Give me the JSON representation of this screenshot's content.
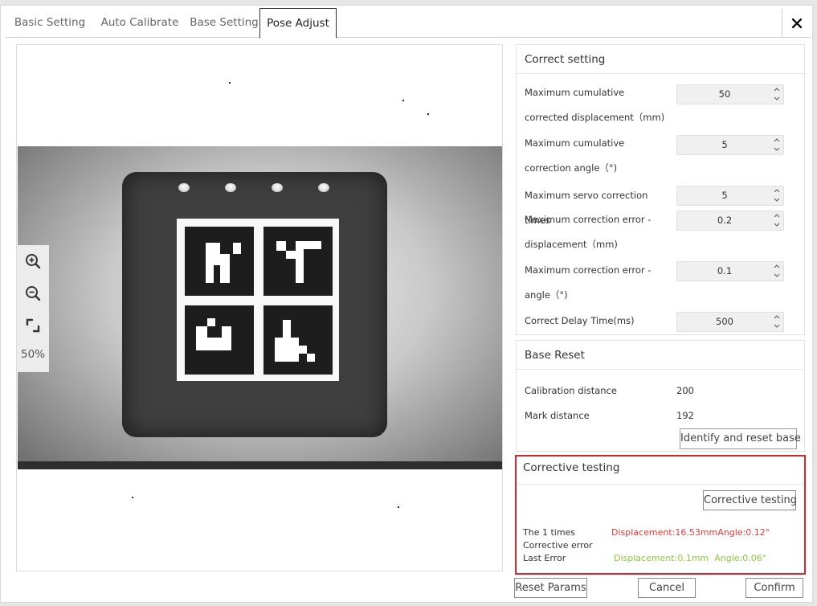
{
  "tabs": [
    "Basic Setting",
    "Auto Calibrate",
    "Base Setting",
    "Pose Adjust"
  ],
  "active_tab": "Pose Adjust",
  "close_icon": "close-icon",
  "viewer": {
    "zoom_level": "50%",
    "tools": [
      "zoom-in-icon",
      "zoom-out-icon",
      "fit-screen-icon"
    ]
  },
  "correct_setting": {
    "title": "Correct setting",
    "rows": [
      {
        "label": "Maximum cumulative corrected displacement（mm)",
        "value": "50"
      },
      {
        "label": "Maximum cumulative correction angle（°)",
        "value": "5"
      },
      {
        "label": "Maximum servo correction times",
        "value": "5"
      },
      {
        "label": "Maximum correction error - displacement（mm)",
        "value": "0.2"
      },
      {
        "label": "Maximum correction error - angle（°)",
        "value": "0.1"
      },
      {
        "label": "Correct Delay Time(ms)",
        "value": "500"
      }
    ]
  },
  "base_reset": {
    "title": "Base Reset",
    "calibration_label": "Calibration distance",
    "calibration_value": "200",
    "mark_label": "Mark distance",
    "mark_value": "192",
    "button": "Identify and reset base"
  },
  "corrective_testing": {
    "title": "Corrective testing",
    "button": "Corrective testing",
    "times_label": "The 1 times",
    "times_result": "Displacement:16.53mmAngle:0.12°",
    "error_label": "Corrective error",
    "last_label": "Last Error",
    "last_result": "Displacement:0.1mm  Angle:0.06°",
    "colors": {
      "highlight_border": "#d9262c",
      "current_result": "#e23a3a",
      "last_result": "#8cc63f"
    }
  },
  "footer": {
    "reset": "Reset Params",
    "cancel": "Cancel",
    "confirm": "Confirm"
  }
}
